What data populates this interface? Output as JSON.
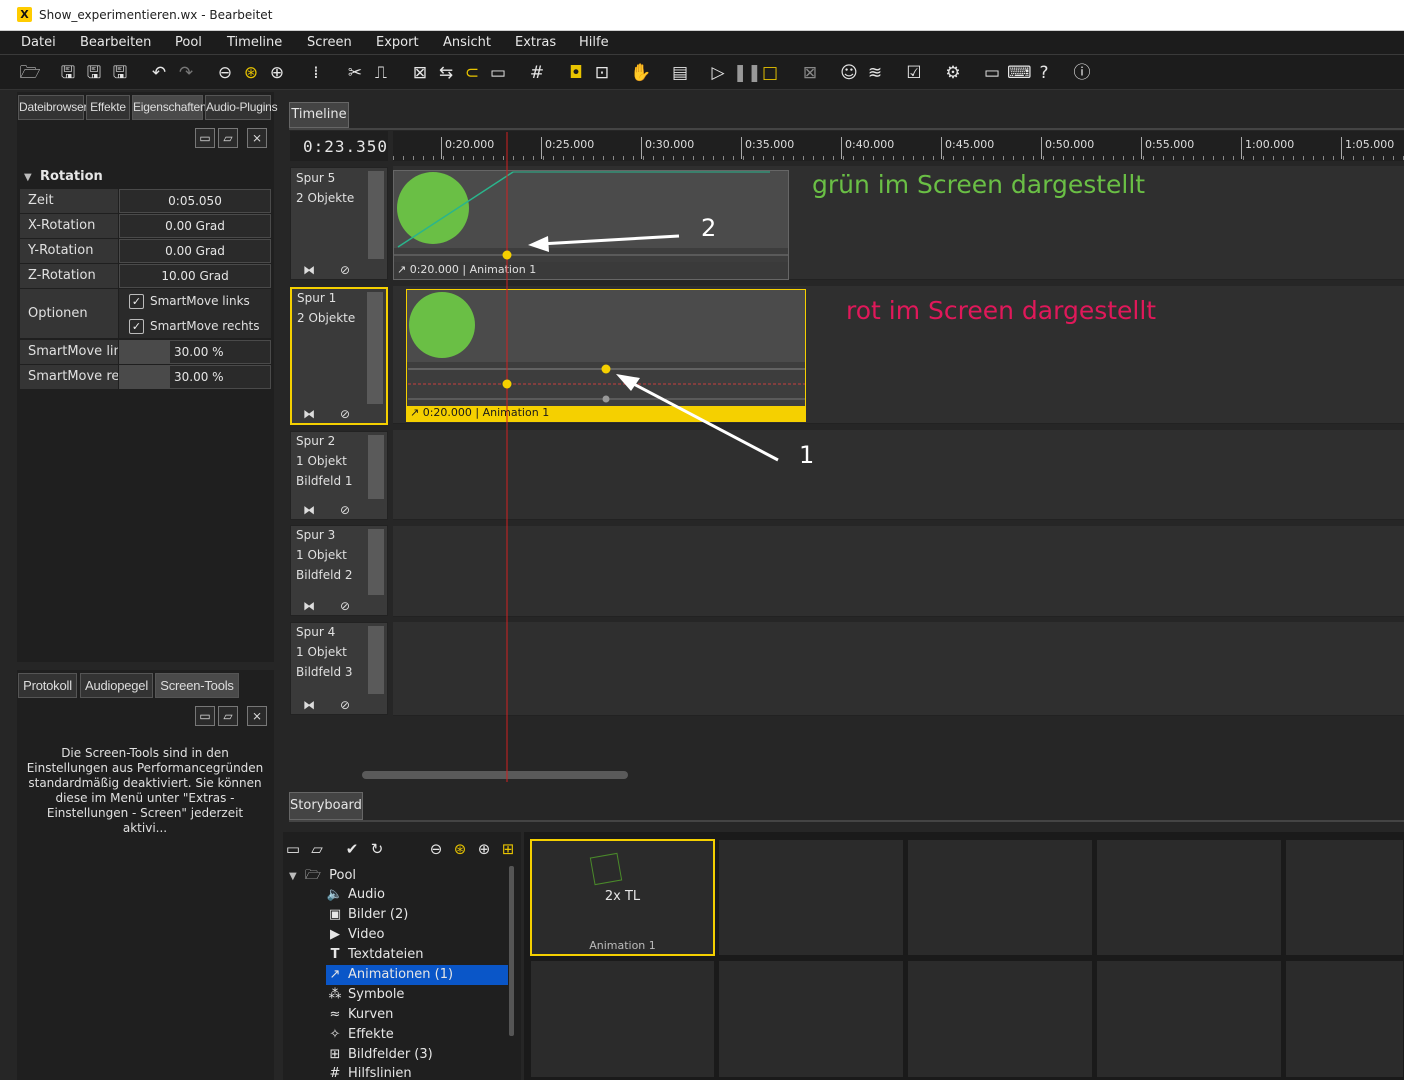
{
  "window": {
    "title": "Show_experimentieren.wx - Bearbeitet",
    "app_icon": "X"
  },
  "menu": [
    "Datei",
    "Bearbeiten",
    "Pool",
    "Timeline",
    "Screen",
    "Export",
    "Ansicht",
    "Extras",
    "Hilfe"
  ],
  "left_tabs": [
    "Dateibrowser",
    "Effekte",
    "Eigenschaften",
    "Audio-Plugins"
  ],
  "properties": {
    "section": "Rotation",
    "rows": [
      {
        "label": "Zeit",
        "value": "0:05.050"
      },
      {
        "label": "X-Rotation",
        "value": "0.00 Grad"
      },
      {
        "label": "Y-Rotation",
        "value": "0.00 Grad"
      },
      {
        "label": "Z-Rotation",
        "value": "10.00 Grad"
      }
    ],
    "options_label": "Optionen",
    "options": [
      {
        "label": "SmartMove links",
        "checked": true
      },
      {
        "label": "SmartMove rechts",
        "checked": true
      }
    ],
    "smart_rows": [
      {
        "label": "SmartMove links",
        "value": "30.00 %"
      },
      {
        "label": "SmartMove rechts",
        "value": "30.00 %"
      }
    ]
  },
  "bottom_tabs": [
    "Protokoll",
    "Audiopegel",
    "Screen-Tools"
  ],
  "screen_tools_text": "Die Screen-Tools sind in den Einstellungen aus Performancegründen standardmäßig deaktiviert. Sie können diese im Menü unter \"Extras - Einstellungen - Screen\" jederzeit aktivi...",
  "timeline": {
    "tab": "Timeline",
    "current_time": "0:23.350",
    "ruler": [
      "0:20.000",
      "0:25.000",
      "0:30.000",
      "0:35.000",
      "0:40.000",
      "0:45.000",
      "0:50.000",
      "0:55.000",
      "1:00.000",
      "1:05.000"
    ],
    "tracks": [
      {
        "name": "Spur 5",
        "count": "2 Objekte",
        "sub": ""
      },
      {
        "name": "Spur 1",
        "count": "2 Objekte",
        "sub": ""
      },
      {
        "name": "Spur 2",
        "count": "1 Objekt",
        "sub": "Bildfeld 1"
      },
      {
        "name": "Spur 3",
        "count": "1 Objekt",
        "sub": "Bildfeld 2"
      },
      {
        "name": "Spur 4",
        "count": "1 Objekt",
        "sub": "Bildfeld 3"
      }
    ],
    "clip1_label": "0:20.000 | Animation 1",
    "clip2_label": "0:20.000 | Animation 1",
    "annotation_green": "grün im Screen dargestellt",
    "annotation_red": "rot im Screen dargestellt",
    "annotation_num1": "1",
    "annotation_num2": "2",
    "colors": {
      "green": "#6abf45",
      "red": "#e0185a",
      "yellow": "#f5d000",
      "playhead": "#d02020"
    }
  },
  "storyboard": {
    "tab": "Storyboard",
    "card_title": "2x TL",
    "card_caption": "Animation 1"
  },
  "pool": {
    "root": "Pool",
    "items": [
      {
        "icon": "speaker-icon",
        "glyph": "🔈",
        "label": "Audio"
      },
      {
        "icon": "image-icon",
        "glyph": "▣",
        "label": "Bilder (2)"
      },
      {
        "icon": "video-icon",
        "glyph": "▶",
        "label": "Video"
      },
      {
        "icon": "text-icon",
        "glyph": "T",
        "label": "Textdateien"
      },
      {
        "icon": "animation-icon",
        "glyph": "↗",
        "label": "Animationen (1)"
      },
      {
        "icon": "symbols-icon",
        "glyph": "⁂",
        "label": "Symbole"
      },
      {
        "icon": "curves-icon",
        "glyph": "≈",
        "label": "Kurven"
      },
      {
        "icon": "effects-icon",
        "glyph": "✧",
        "label": "Effekte"
      },
      {
        "icon": "grid-icon",
        "glyph": "⊞",
        "label": "Bildfelder (3)"
      },
      {
        "icon": "guides-icon",
        "glyph": "#",
        "label": "Hilfslinien"
      }
    ]
  }
}
